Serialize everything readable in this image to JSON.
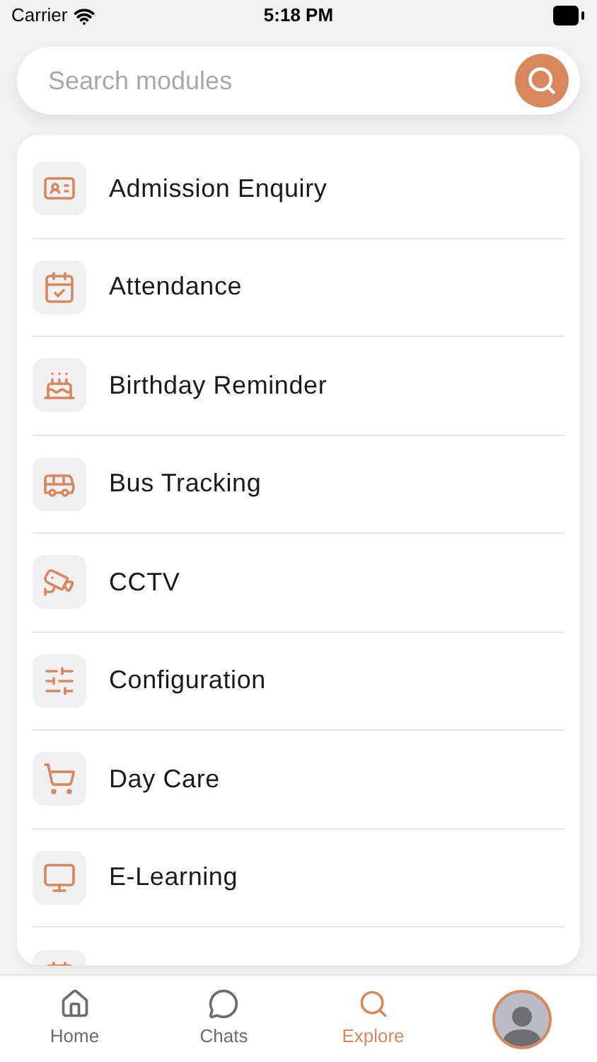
{
  "status_bar": {
    "carrier": "Carrier",
    "time": "5:18 PM"
  },
  "search": {
    "placeholder": "Search modules"
  },
  "modules": [
    {
      "label": "Admission Enquiry"
    },
    {
      "label": "Attendance"
    },
    {
      "label": "Birthday Reminder"
    },
    {
      "label": "Bus Tracking"
    },
    {
      "label": "CCTV"
    },
    {
      "label": "Configuration"
    },
    {
      "label": "Day Care"
    },
    {
      "label": "E-Learning"
    }
  ],
  "tab_bar": [
    {
      "kind": "home",
      "label": "Home",
      "selected": false
    },
    {
      "kind": "chats",
      "label": "Chats",
      "selected": false
    },
    {
      "kind": "explore",
      "label": "Explore",
      "selected": true
    },
    {
      "kind": "avatar",
      "selected": false
    }
  ]
}
